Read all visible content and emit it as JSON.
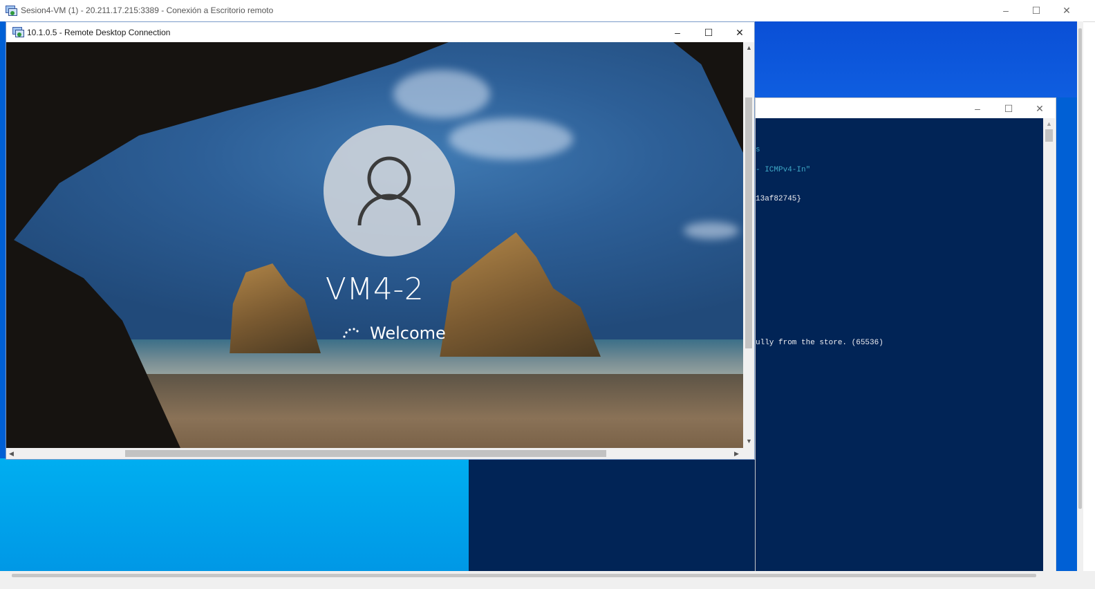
{
  "outer_window": {
    "title": "Sesion4-VM (1) - 20.211.17.215:3389 - Conexión a Escritorio remoto",
    "controls": {
      "minimize": "–",
      "maximize": "☐",
      "close": "✕"
    }
  },
  "inner_window": {
    "title": "10.1.0.5 - Remote Desktop Connection",
    "controls": {
      "minimize": "–",
      "maximize": "☐",
      "close": "✕"
    }
  },
  "login_screen": {
    "machine_name": "VM4-2",
    "status_text": "Welcome"
  },
  "powershell": {
    "controls": {
      "minimize": "–",
      "maximize": "☐",
      "close": "✕"
    },
    "lines": [
      {
        "text": "s",
        "color": "#3fa8c6"
      },
      {
        "text": "- ICMPv4-In\"",
        "color": "#3fa8c6"
      },
      {
        "text": "13af82745}",
        "color": "#eeedf0"
      },
      {
        "text": "ully from the store. (65536)",
        "color": "#eeedf0"
      }
    ]
  },
  "scrollbars": {
    "up_arrow": "▲",
    "down_arrow": "▼",
    "left_arrow": "◀",
    "right_arrow": "▶"
  },
  "colors": {
    "console_bg": "#012456",
    "desktop_blue": "#0060d5",
    "light_blue": "#00aef0"
  }
}
